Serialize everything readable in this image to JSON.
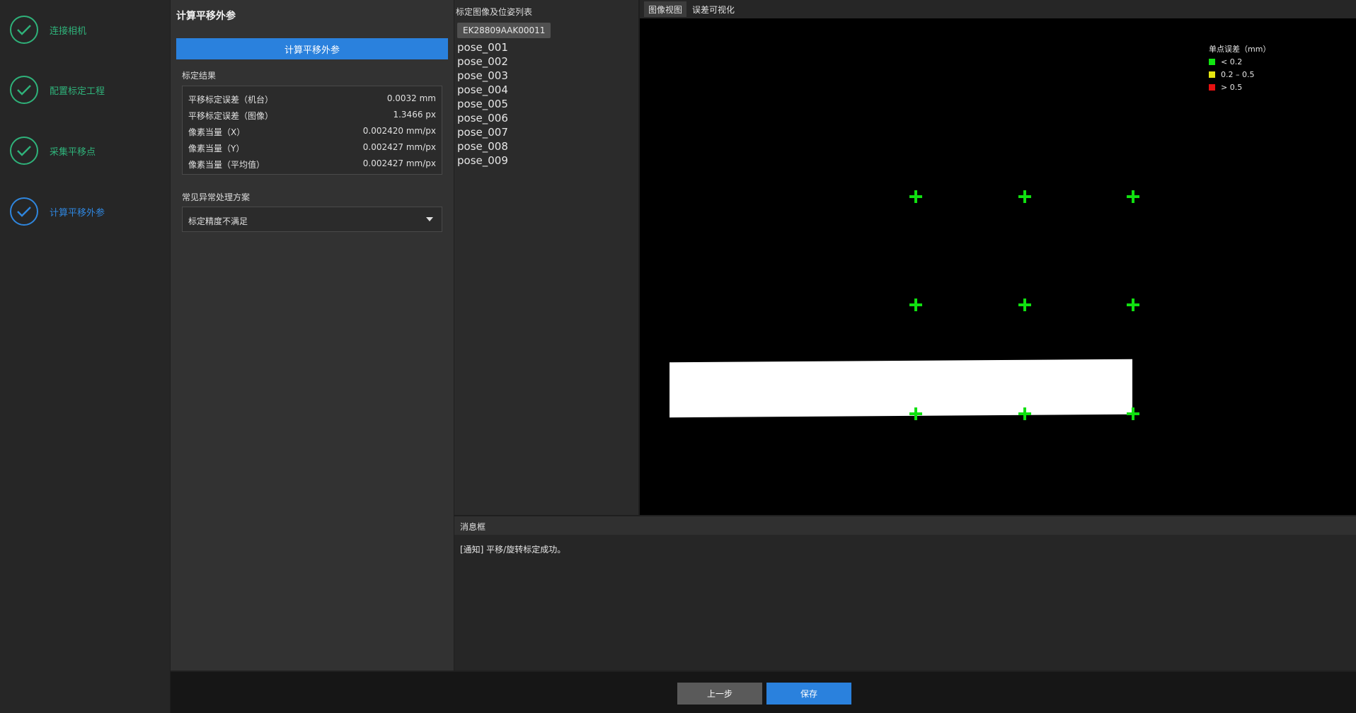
{
  "steps": [
    {
      "label": "连接相机",
      "state": "done"
    },
    {
      "label": "配置标定工程",
      "state": "done"
    },
    {
      "label": "采集平移点",
      "state": "done"
    },
    {
      "label": "计算平移外参",
      "state": "active"
    }
  ],
  "settings": {
    "title": "计算平移外参",
    "compute_button": "计算平移外参",
    "results_title": "标定结果",
    "results": [
      {
        "key": "平移标定误差（机台）",
        "value": "0.0032 mm"
      },
      {
        "key": "平移标定误差（图像）",
        "value": "1.3466 px"
      },
      {
        "key": "像素当量（X）",
        "value": "0.002420 mm/px"
      },
      {
        "key": "像素当量（Y）",
        "value": "0.002427 mm/px"
      },
      {
        "key": "像素当量（平均值）",
        "value": "0.002427 mm/px"
      }
    ],
    "troubleshoot_title": "常见异常处理方案",
    "troubleshoot_selected": "标定精度不满足"
  },
  "pose_list": {
    "header": "标定图像及位姿列表",
    "camera_tab": "EK28809AAK00011",
    "poses": [
      "pose_001",
      "pose_002",
      "pose_003",
      "pose_004",
      "pose_005",
      "pose_006",
      "pose_007",
      "pose_008",
      "pose_009"
    ]
  },
  "viewer": {
    "tabs": [
      "图像视图",
      "误差可视化"
    ],
    "active_tab": 0,
    "legend": {
      "title": "单点误差（mm）",
      "items": [
        {
          "label": "< 0.2",
          "color": "#11e611"
        },
        {
          "label": "0.2 – 0.5",
          "color": "#e6e611"
        },
        {
          "label": "> 0.5",
          "color": "#e61111"
        }
      ]
    },
    "point_color": "#10e010"
  },
  "messages": {
    "header": "消息框",
    "lines": [
      "[通知] 平移/旋转标定成功。"
    ]
  },
  "footer": {
    "prev_label": "上一步",
    "save_label": "保存"
  }
}
